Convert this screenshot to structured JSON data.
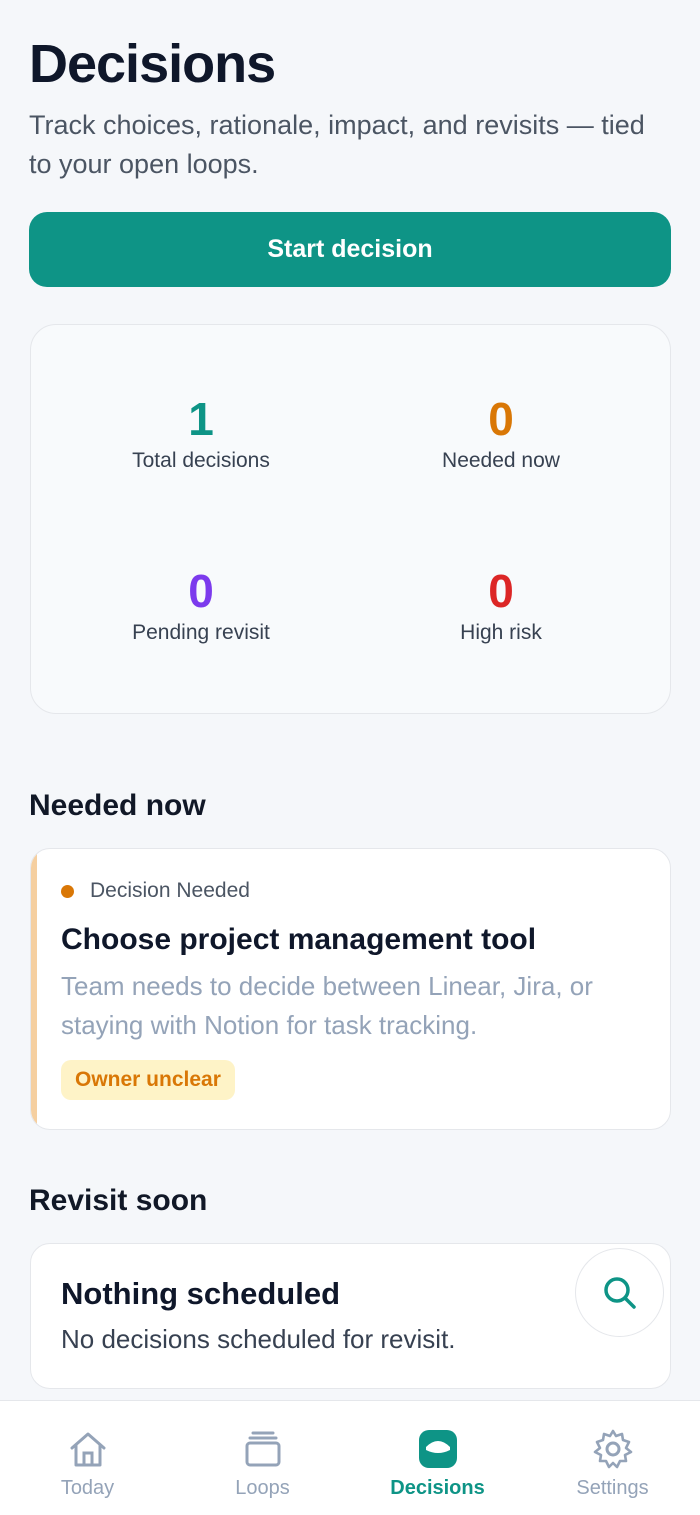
{
  "header": {
    "title": "Decisions",
    "subtitle": "Track choices, rationale, impact, and revisits — tied to your open loops."
  },
  "start_button": {
    "label": "Start decision"
  },
  "stats": [
    {
      "value": "1",
      "label": "Total decisions",
      "color": "#0e9486"
    },
    {
      "value": "0",
      "label": "Needed now",
      "color": "#d97706"
    },
    {
      "value": "0",
      "label": "Pending revisit",
      "color": "#7c3aed"
    },
    {
      "value": "0",
      "label": "High risk",
      "color": "#dc2626"
    }
  ],
  "needed_now": {
    "section_title": "Needed now",
    "card": {
      "status": "Decision Needed",
      "status_color": "#d97706",
      "title": "Choose project management tool",
      "description": "Team needs to decide between Linear, Jira, or staying with Notion for task tracking.",
      "tag": "Owner unclear"
    }
  },
  "revisit_soon": {
    "section_title": "Revisit soon",
    "empty_title": "Nothing scheduled",
    "empty_text": "No decisions scheduled for revisit."
  },
  "search_button": {
    "icon": "search-icon"
  },
  "tabbar": {
    "tabs": [
      {
        "label": "Today",
        "icon": "home-icon",
        "active": false
      },
      {
        "label": "Loops",
        "icon": "layers-icon",
        "active": false
      },
      {
        "label": "Decisions",
        "icon": "decisions-icon",
        "active": true
      },
      {
        "label": "Settings",
        "icon": "gear-icon",
        "active": false
      }
    ]
  }
}
